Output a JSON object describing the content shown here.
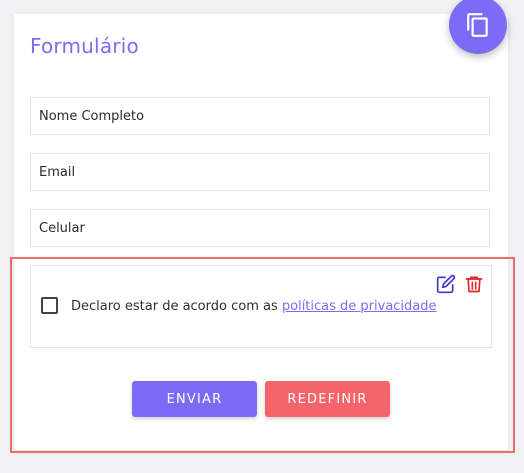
{
  "form": {
    "title": "Formulário",
    "fields": [
      {
        "placeholder": "Nome Completo"
      },
      {
        "placeholder": "Email"
      },
      {
        "placeholder": "Celular"
      }
    ],
    "policy": {
      "text": "Declaro estar de acordo com as",
      "link": "políticas de privacidade"
    },
    "buttons": {
      "submit": "ENVIAR",
      "reset": "REDEFINIR"
    }
  },
  "icons": {
    "fab": "copy-icon",
    "edit": "edit-icon",
    "delete": "trash-icon"
  },
  "colors": {
    "accent": "#7b6cf6",
    "danger": "#f5646a",
    "selection": "#ef6b6f",
    "edit_icon": "#3f35d6",
    "delete_icon": "#e02424"
  }
}
